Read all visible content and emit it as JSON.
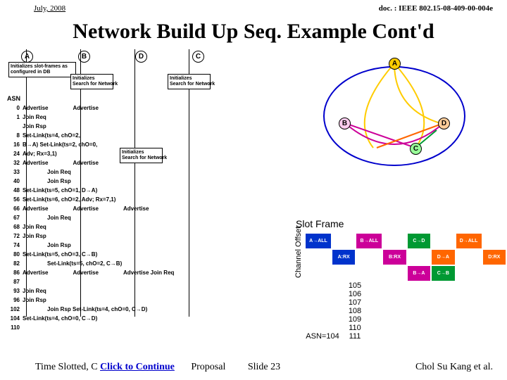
{
  "header": {
    "left": "July, 2008",
    "right": "doc. : IEEE 802.15-08-409-00-004e"
  },
  "title": "Network Build Up Seq. Example Cont'd",
  "nodes": [
    "A",
    "B",
    "D",
    "C"
  ],
  "init": {
    "a": "Initializes slot-frames as configured in DB",
    "b": "Initializes\nSearch for Network",
    "c": "Initializes\nSearch for Network",
    "d": "Initializes\nSearch for Network"
  },
  "asn": "ASN",
  "seq": [
    {
      "n": "0",
      "t": "Advertise",
      "t2": "Advertise"
    },
    {
      "n": "1",
      "t": "Join Req"
    },
    {
      "n": "",
      "t": "Join Rsp"
    },
    {
      "n": "8",
      "t": "Set-Link(ts=4, chO=2,"
    },
    {
      "n": "16",
      "t": "B→A)\nSet-Link(ts=2, chO=0,"
    },
    {
      "n": "24",
      "t": "Adv; Rx=3,1)"
    },
    {
      "n": "32",
      "t": "Advertise",
      "t2": "Advertise"
    },
    {
      "n": "33",
      "t": "",
      "t2": "Join Req"
    },
    {
      "n": "40",
      "t": "",
      "t2": "Join Rsp"
    },
    {
      "n": "48",
      "t": "Set-Link(ts=5, chO=1, D→A)"
    },
    {
      "n": "56",
      "t": "Set-Link(ts=6, chO=2, Adv; Rx=7,1)"
    },
    {
      "n": "66",
      "t": "Advertise",
      "t2": "Advertise",
      "t3": "Advertise"
    },
    {
      "n": "67",
      "t": "",
      "t2": "Join Req"
    },
    {
      "n": "68",
      "t": "Join Req"
    },
    {
      "n": "72",
      "t": "Join Rsp"
    },
    {
      "n": "74",
      "t": "",
      "t2": "Join Rsp"
    },
    {
      "n": "80",
      "t": "Set-Link(ts=5, chO=3, C→B)"
    },
    {
      "n": "82",
      "t": "",
      "t2": "Set-Link(ts=5, chO=2, C→B)"
    },
    {
      "n": "86",
      "t": "Advertise",
      "t2": "Advertise",
      "t3": "Advertise\nJoin Req"
    },
    {
      "n": "87",
      "t": ""
    },
    {
      "n": "93",
      "t": "Join Req"
    },
    {
      "n": "96",
      "t": "Join Rsp"
    },
    {
      "n": "102",
      "t": "",
      "t3": "Join Rsp\nSet-Link(ts=4, chO=0, C→D)"
    },
    {
      "n": "104",
      "t": "Set-Link(ts=4, chO=0, C→D)"
    },
    {
      "n": "110",
      "t": ""
    }
  ],
  "slotframe_label": "Slot Frame",
  "channel_label": "Channel Offset",
  "cells": [
    [
      {
        "t": "A→ALL",
        "c": "#0033cc"
      },
      null,
      {
        "t": "B→ALL",
        "c": "#cc0099"
      },
      null,
      {
        "t": "C→D",
        "c": "#009933"
      },
      null,
      {
        "t": "D→ALL",
        "c": "#ff6600"
      },
      null
    ],
    [
      null,
      {
        "t": "A:RX",
        "c": "#0033cc"
      },
      null,
      {
        "t": "B:RX",
        "c": "#cc0099"
      },
      null,
      {
        "t": "D→A",
        "c": "#ff6600"
      },
      null,
      {
        "t": "D:RX",
        "c": "#ff6600"
      }
    ],
    [
      null,
      null,
      null,
      null,
      {
        "t": "B→A",
        "c": "#cc0099"
      },
      {
        "t": "C→B",
        "c": "#009933"
      },
      null,
      null
    ]
  ],
  "asnrow": {
    "label": "ASN=104",
    "vals": [
      "105",
      "106",
      "107",
      "108",
      "109",
      "110",
      "111"
    ]
  },
  "footer": {
    "left": "Time Slotted, C",
    "click": "Click to Continue",
    "mid": "Proposal",
    "slide": "Slide 23",
    "right": "Chol Su Kang et al."
  }
}
